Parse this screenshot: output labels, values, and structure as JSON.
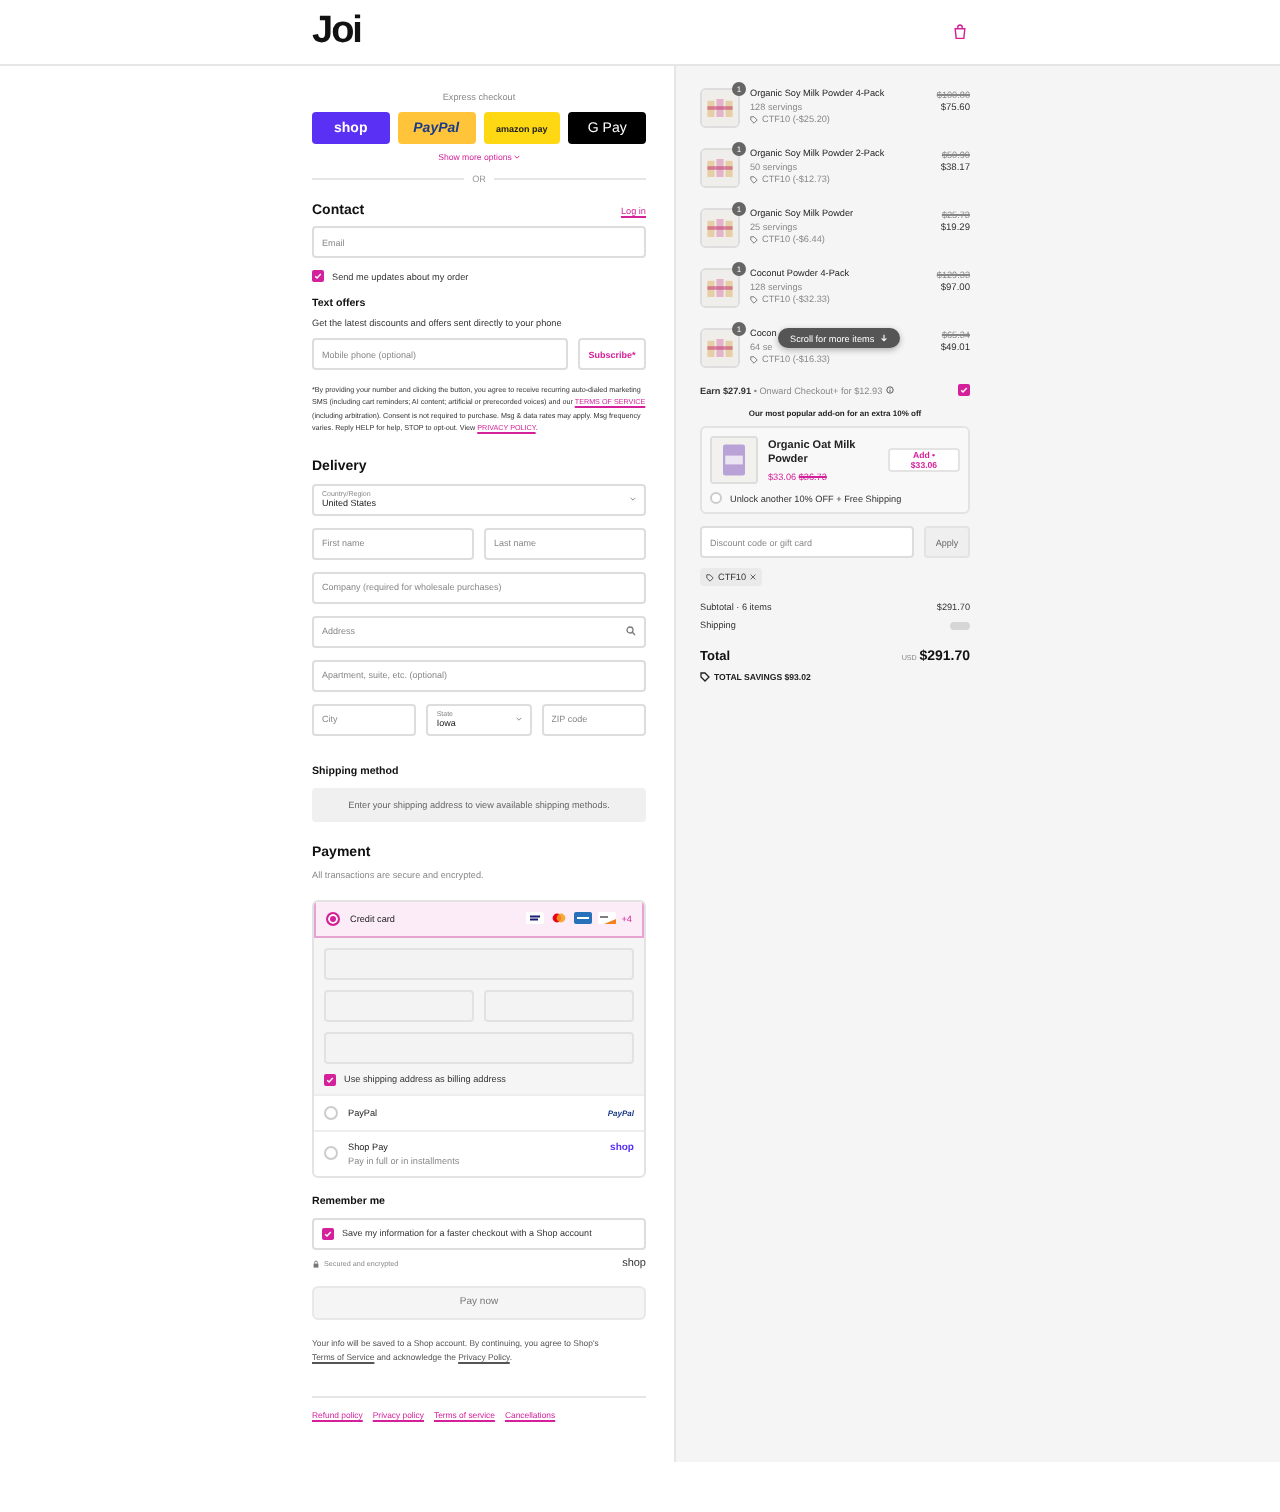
{
  "header": {
    "logo": "Joi"
  },
  "express": {
    "title": "Express checkout",
    "buttons": [
      {
        "kind": "shop",
        "label": "shop"
      },
      {
        "kind": "paypal",
        "label": "PayPal"
      },
      {
        "kind": "amazon",
        "label": "amazon pay"
      },
      {
        "kind": "gpay",
        "label": "G Pay"
      }
    ],
    "more": "Show more options",
    "or": "OR"
  },
  "contact": {
    "title": "Contact",
    "login": "Log in",
    "email": {
      "placeholder": "Email"
    },
    "updates": {
      "label": "Send me updates about my order",
      "checked": true
    }
  },
  "text_offers": {
    "title": "Text offers",
    "subtitle": "Get the latest discounts and offers sent directly to your phone",
    "phone": {
      "placeholder": "Mobile phone (optional)"
    },
    "subscribe": "Subscribe*",
    "disclaimer": [
      {
        "text": "*By providing your number and clicking the button, you agree to receive recurring auto-dialed marketing SMS (including cart reminders; AI content; artificial or prerecorded voices) and our "
      },
      {
        "link": "TERMS OF SERVICE"
      },
      {
        "text": " (including arbitration). Consent is not required to purchase. Msg & data rates may apply. Msg frequency varies. Reply HELP for help, STOP to opt-out. View "
      },
      {
        "link": "PRIVACY POLICY"
      },
      {
        "text": "."
      }
    ]
  },
  "delivery": {
    "title": "Delivery",
    "country": {
      "label": "Country/Region",
      "value": "United States"
    },
    "first_name": {
      "placeholder": "First name"
    },
    "last_name": {
      "placeholder": "Last name"
    },
    "company": {
      "placeholder": "Company (required for wholesale purchases)"
    },
    "address": {
      "placeholder": "Address"
    },
    "apartment": {
      "placeholder": "Apartment, suite, etc. (optional)"
    },
    "city": {
      "placeholder": "City"
    },
    "state": {
      "label": "State",
      "value": "Iowa"
    },
    "zip": {
      "placeholder": "ZIP code"
    }
  },
  "shipping_method": {
    "title": "Shipping method",
    "notice": "Enter your shipping address to view available shipping methods."
  },
  "payment": {
    "title": "Payment",
    "subtitle": "All transactions are secure and encrypted.",
    "more_cards": "+4",
    "methods": [
      {
        "kind": "card",
        "label": "Credit card",
        "selected": true
      },
      {
        "kind": "paypal",
        "label": "PayPal",
        "logo": "PayPal",
        "selected": false
      },
      {
        "kind": "shoppay",
        "label": "Shop Pay",
        "sub": "Pay in full or in installments",
        "logo": "shop",
        "selected": false
      }
    ],
    "billing": {
      "label": "Use shipping address as billing address",
      "checked": true
    }
  },
  "remember": {
    "title": "Remember me",
    "save": {
      "label": "Save my information for a faster checkout with a Shop account",
      "checked": true
    },
    "secure": "Secured and encrypted",
    "logo": "shop"
  },
  "pay_button": {
    "label": "Pay now",
    "disabled": true
  },
  "legal": [
    {
      "text": "Your info will be saved to a Shop account. By continuing, you agree to Shop's "
    },
    {
      "link": "Terms of Service"
    },
    {
      "text": " and acknowledge the "
    },
    {
      "link": "Privacy Policy"
    },
    {
      "text": "."
    }
  ],
  "footer_links": [
    "Refund policy",
    "Privacy policy",
    "Terms of service",
    "Cancellations"
  ],
  "cart": {
    "items": [
      {
        "name": "Organic Soy Milk Powder 4-Pack",
        "servings": "128 servings",
        "discount": "CTF10 (-$25.20)",
        "old_price": "$100.80",
        "price": "$75.60",
        "qty": "1"
      },
      {
        "name": "Organic Soy Milk Powder 2-Pack",
        "servings": "50 servings",
        "discount": "CTF10 (-$12.73)",
        "old_price": "$50.90",
        "price": "$38.17",
        "qty": "1"
      },
      {
        "name": "Organic Soy Milk Powder",
        "servings": "25 servings",
        "discount": "CTF10 (-$6.44)",
        "old_price": "$25.73",
        "price": "$19.29",
        "qty": "1"
      },
      {
        "name": "Coconut Powder 4-Pack",
        "servings": "128 servings",
        "discount": "CTF10 (-$32.33)",
        "old_price": "$129.33",
        "price": "$97.00",
        "qty": "1"
      },
      {
        "name": "Cocon",
        "servings": "64 se",
        "discount": "CTF10 (-$16.33)",
        "old_price": "$65.34",
        "price": "$49.01",
        "qty": "1"
      }
    ],
    "toast": "Scroll for more items",
    "earn": {
      "amount": "Earn $27.91",
      "text": "• Onward Checkout+ for $12.93",
      "checked": true
    },
    "addon": {
      "heading": "Our most popular add-on for an extra 10% off",
      "name": "Organic Oat Milk Powder",
      "price": "$33.06",
      "old_price": "$36.73",
      "button": "Add • $33.06",
      "unlock": {
        "label": "Unlock another 10% OFF + Free Shipping",
        "checked": false
      }
    },
    "discount": {
      "placeholder": "Discount code or gift card",
      "apply": "Apply",
      "tag": "CTF10"
    },
    "subtotal": {
      "label": "Subtotal · 6 items",
      "value": "$291.70"
    },
    "shipping": {
      "label": "Shipping"
    },
    "total": {
      "label": "Total",
      "currency": "USD",
      "value": "$291.70"
    },
    "savings": "TOTAL SAVINGS $93.02"
  }
}
